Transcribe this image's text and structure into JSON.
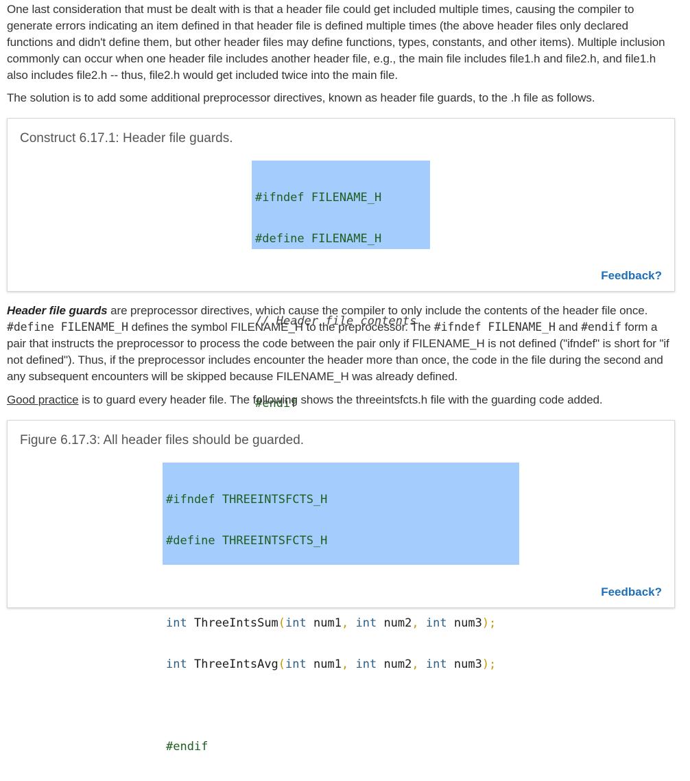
{
  "intro": {
    "p1": "One last consideration that must be dealt with is that a header file could get included multiple times, causing the compiler to generate errors indicating an item defined in that header file is defined multiple times (the above header files only declared functions and didn't define them, but other header files may define functions, types, constants, and other items). Multiple inclusion commonly can occur when one header file includes another header file, e.g., the main file includes file1.h and file2.h, and file1.h also includes file2.h -- thus, file2.h would get included twice into the main file.",
    "p2": "The solution is to add some additional preprocessor directives, known as header file guards, to the .h file as follows."
  },
  "construct": {
    "title": "Construct 6.17.1: Header file guards.",
    "code": {
      "line1": "#ifndef FILENAME_H",
      "line2": "#define FILENAME_H",
      "line3": "// Header file contents",
      "line4": "#endif"
    },
    "feedback_label": "Feedback?"
  },
  "explanation": {
    "term": "Header file guards",
    "t1": " are preprocessor directives, which cause the compiler to only include the contents of the header file once. ",
    "c1": "#define FILENAME_H",
    "t2": " defines the symbol FILENAME_H to the preprocessor. The ",
    "c2": "#ifndef FILENAME_H",
    "t3": " and ",
    "c3": "#endif",
    "t4": " form a pair that instructs the preprocessor to process the code between the pair only if FILENAME_H is not defined (\"ifndef\" is short for \"if not defined\"). Thus, if the preprocessor includes encounter the header more than once, the code in the file during the second and any subsequent encounters will be skipped because FILENAME_H was already defined."
  },
  "practice": {
    "link": "Good practice",
    "text": " is to guard every header file. The following shows the threeintsfcts.h file with the guarding code added."
  },
  "figure": {
    "title": "Figure 6.17.3: All header files should be guarded.",
    "code": {
      "line1": "#ifndef THREEINTSFCTS_H",
      "line2": "#define THREEINTSFCTS_H",
      "kw_int": "int",
      "fn1": "ThreeIntsSum",
      "fn2": "ThreeIntsAvg",
      "p_num1": "num1",
      "p_num2": "num2",
      "p_num3": "num3",
      "open_paren": "(",
      "comma": ",",
      "close": ");",
      "line_end": "#endif"
    },
    "feedback_label": "Feedback?"
  }
}
